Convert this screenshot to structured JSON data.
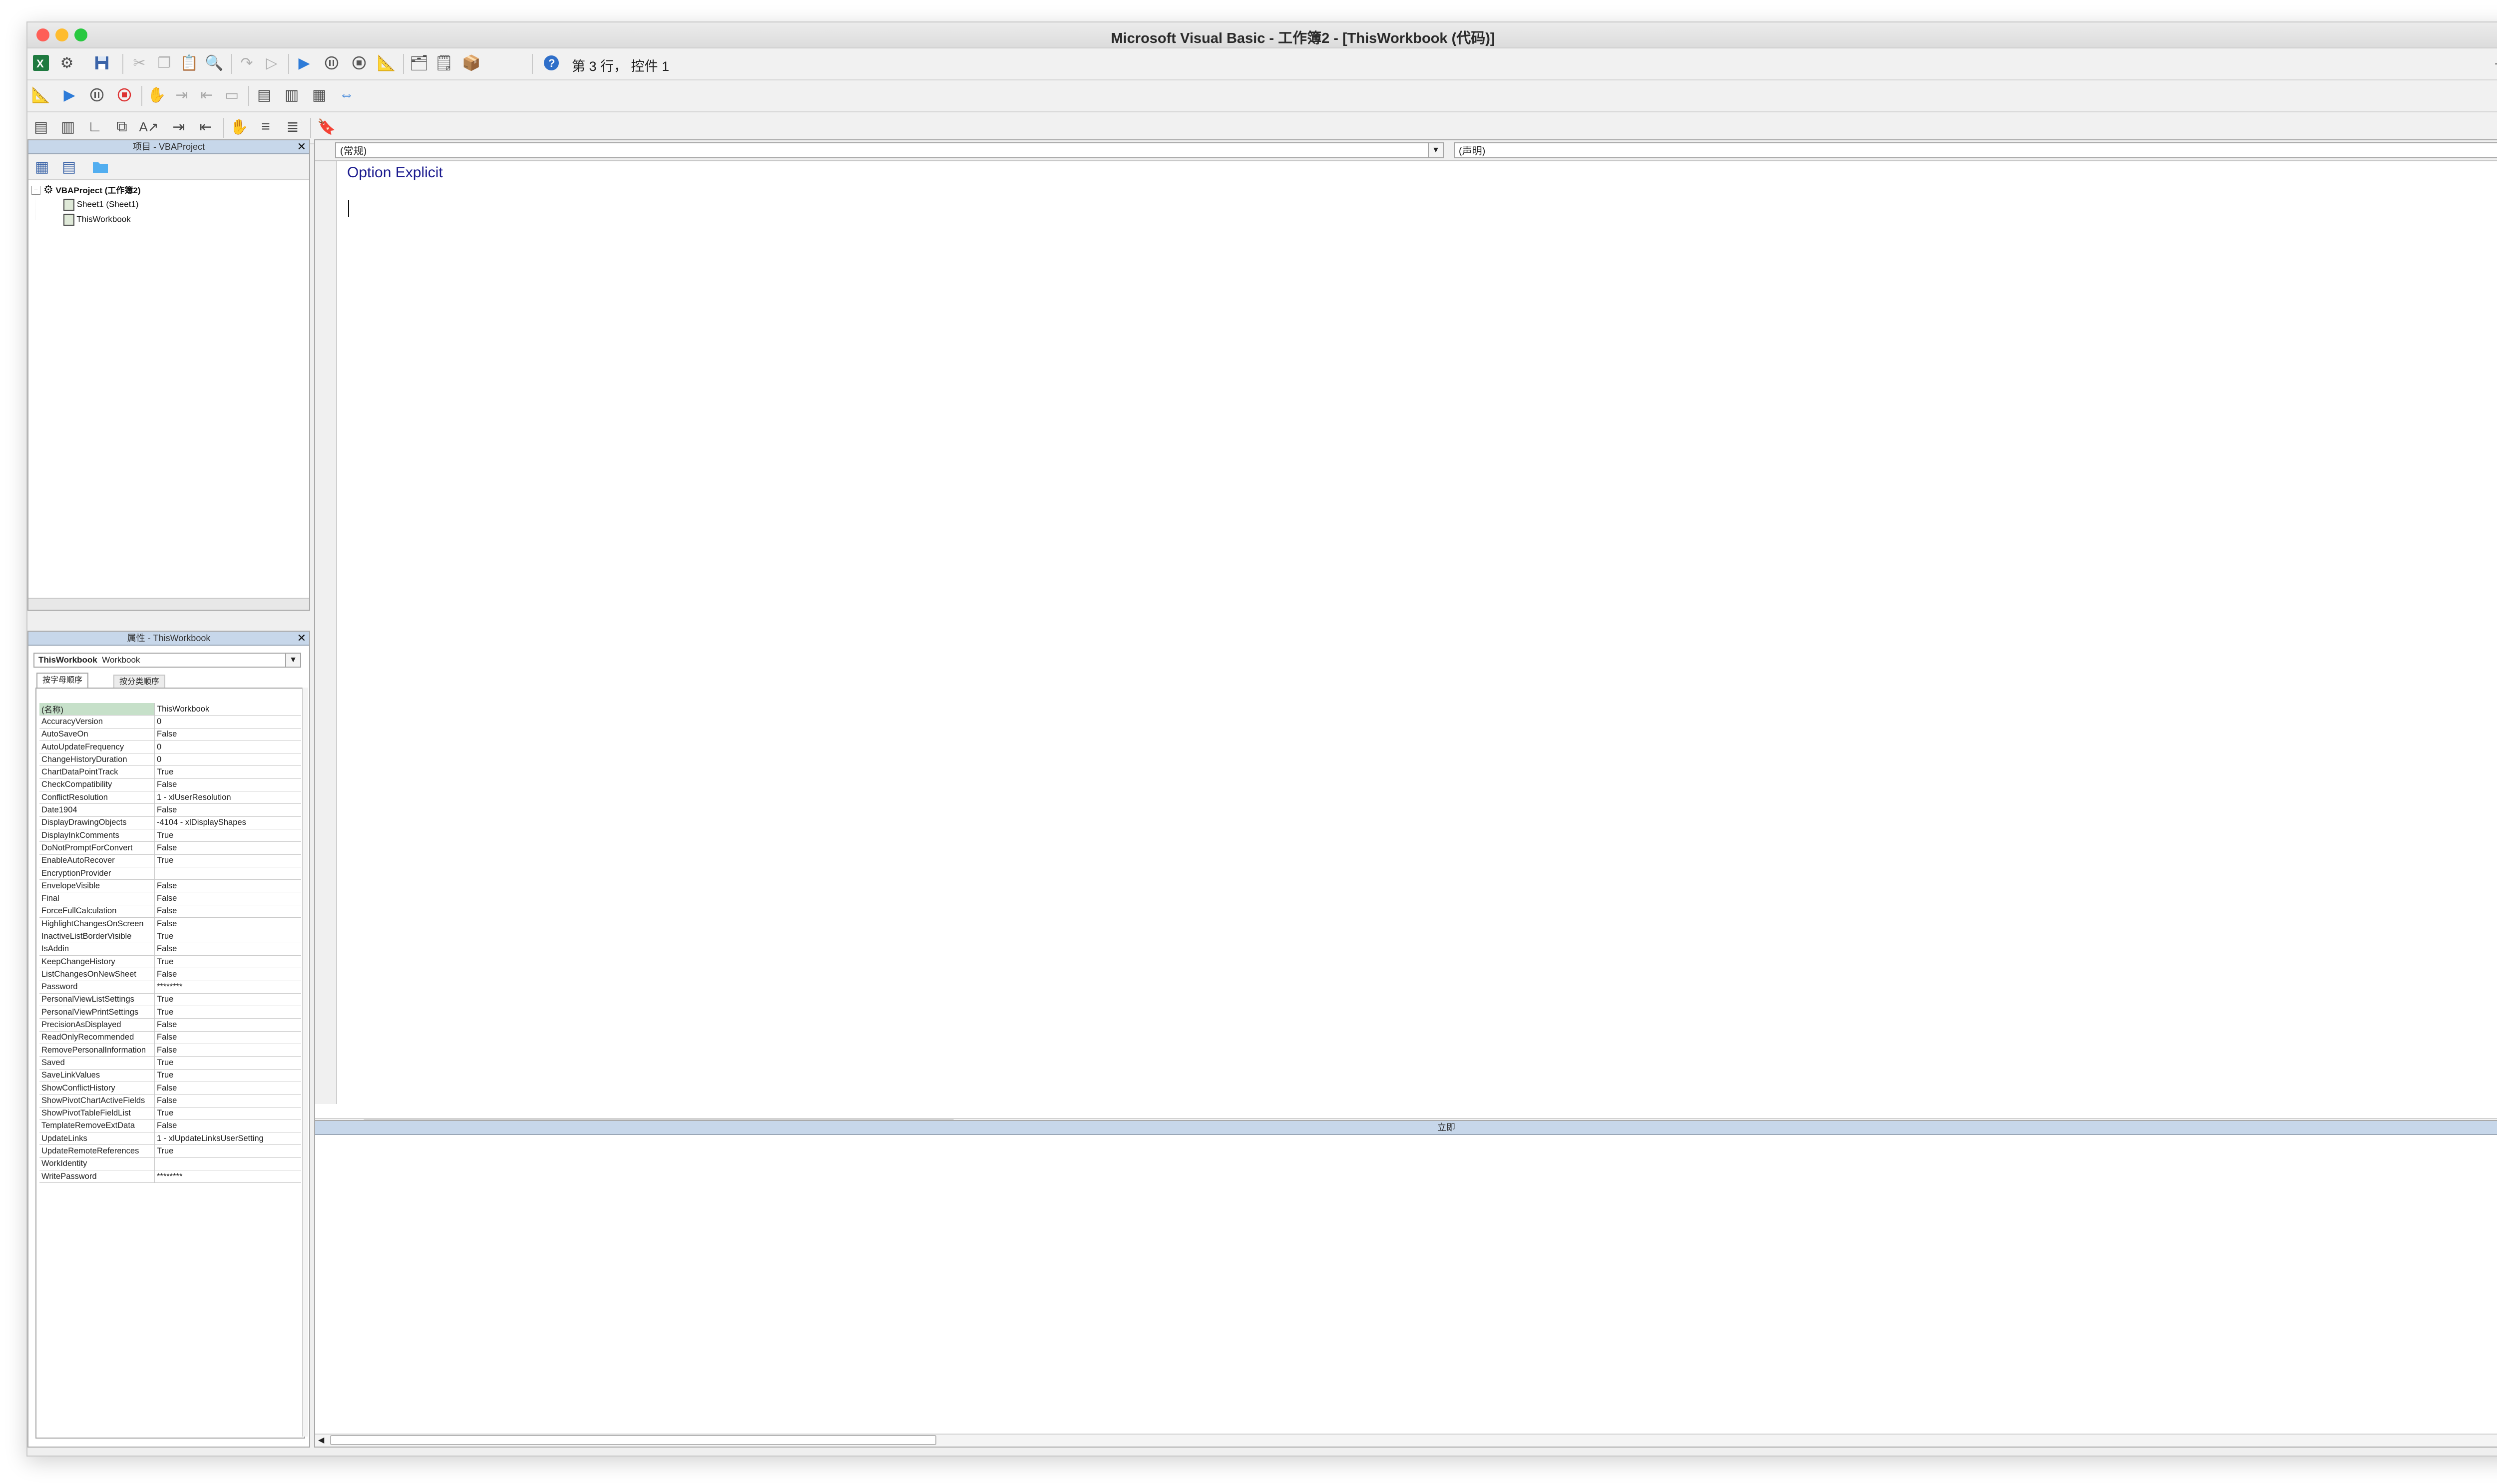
{
  "window": {
    "title": "Microsoft Visual Basic - 工作簿2 - [ThisWorkbook (代码)]"
  },
  "toolbar": {
    "status": "第 3 行， 控件 1"
  },
  "project_panel": {
    "title": "项目 - VBAProject",
    "items": [
      {
        "label": "VBAProject (工作簿2)"
      },
      {
        "label": "Sheet1 (Sheet1)"
      },
      {
        "label": "ThisWorkbook"
      }
    ]
  },
  "properties_panel": {
    "title": "属性 - ThisWorkbook",
    "object_select": {
      "name": "ThisWorkbook",
      "type": "Workbook"
    },
    "tabs": [
      "按字母顺序",
      "按分类顺序"
    ],
    "rows": [
      {
        "name": "(名称)",
        "value": "ThisWorkbook"
      },
      {
        "name": "AccuracyVersion",
        "value": "0"
      },
      {
        "name": "AutoSaveOn",
        "value": "False"
      },
      {
        "name": "AutoUpdateFrequency",
        "value": "0"
      },
      {
        "name": "ChangeHistoryDuration",
        "value": "0"
      },
      {
        "name": "ChartDataPointTrack",
        "value": "True"
      },
      {
        "name": "CheckCompatibility",
        "value": "False"
      },
      {
        "name": "ConflictResolution",
        "value": "1 - xlUserResolution"
      },
      {
        "name": "Date1904",
        "value": "False"
      },
      {
        "name": "DisplayDrawingObjects",
        "value": "-4104 - xlDisplayShapes"
      },
      {
        "name": "DisplayInkComments",
        "value": "True"
      },
      {
        "name": "DoNotPromptForConvert",
        "value": "False"
      },
      {
        "name": "EnableAutoRecover",
        "value": "True"
      },
      {
        "name": "EncryptionProvider",
        "value": ""
      },
      {
        "name": "EnvelopeVisible",
        "value": "False"
      },
      {
        "name": "Final",
        "value": "False"
      },
      {
        "name": "ForceFullCalculation",
        "value": "False"
      },
      {
        "name": "HighlightChangesOnScreen",
        "value": "False"
      },
      {
        "name": "InactiveListBorderVisible",
        "value": "True"
      },
      {
        "name": "IsAddin",
        "value": "False"
      },
      {
        "name": "KeepChangeHistory",
        "value": "True"
      },
      {
        "name": "ListChangesOnNewSheet",
        "value": "False"
      },
      {
        "name": "Password",
        "value": "********"
      },
      {
        "name": "PersonalViewListSettings",
        "value": "True"
      },
      {
        "name": "PersonalViewPrintSettings",
        "value": "True"
      },
      {
        "name": "PrecisionAsDisplayed",
        "value": "False"
      },
      {
        "name": "ReadOnlyRecommended",
        "value": "False"
      },
      {
        "name": "RemovePersonalInformation",
        "value": "False"
      },
      {
        "name": "Saved",
        "value": "True"
      },
      {
        "name": "SaveLinkValues",
        "value": "True"
      },
      {
        "name": "ShowConflictHistory",
        "value": "False"
      },
      {
        "name": "ShowPivotChartActiveFields",
        "value": "False"
      },
      {
        "name": "ShowPivotTableFieldList",
        "value": "True"
      },
      {
        "name": "TemplateRemoveExtData",
        "value": "False"
      },
      {
        "name": "UpdateLinks",
        "value": "1 - xlUpdateLinksUserSetting"
      },
      {
        "name": "UpdateRemoteReferences",
        "value": "True"
      },
      {
        "name": "WorkIdentity",
        "value": ""
      },
      {
        "name": "WritePassword",
        "value": "********"
      }
    ]
  },
  "code_window": {
    "object_dropdown": "(常规)",
    "procedure_dropdown": "(声明)",
    "code": "Option Explicit"
  },
  "immediate_window": {
    "title": "立即"
  },
  "colors": {
    "keyword": "#1c1c8f",
    "panel_title": "#c7d7ea",
    "selected_row": "#c6e0c9"
  }
}
